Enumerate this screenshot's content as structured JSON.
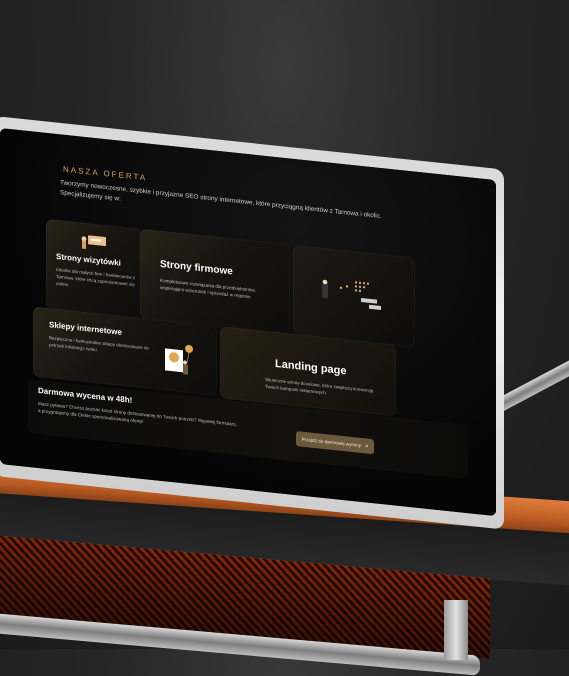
{
  "offer": {
    "eyebrow": "NASZA OFERTA",
    "intro": "Tworzymy nowoczesne, szybkie i przyjazne SEO strony internetowe, które przyciągną klientów z Tarnowa i okolic. Specjalizujemy się w:"
  },
  "cards": [
    {
      "title": "Strony wizytówki",
      "desc": "Idealne dla małych firm i freelancerów z Tarnowa, które chcą zaprezentować się online"
    },
    {
      "title": "Strony firmowe",
      "desc": "Kompleksowe rozwiązania dla przedsiębiorstw, wspierające wizerunek i sprzedaż w regionie"
    },
    {
      "title": "Sklepy internetowe",
      "desc": "Bezpieczne i funkcjonalne sklepy dostosowane do potrzeb lokalnego rynku"
    },
    {
      "title": "Landing page",
      "desc": "Skuteczne strony docelowe, które zwiększą konwersję Twoich kampanii reklamowych."
    }
  ],
  "cta": {
    "title": "Darmowa wycena w 48h!",
    "desc": "Masz pytania? Chcesz poznać koszt strony dostosowanej do Twoich potrzeb? Wypełnij formularz, a przygotujemy dla Ciebie spersonalizowaną ofertę!",
    "button": "Przejdź do darmowej wyceny",
    "button_icon": "double-chevron-right-icon",
    "accent": "#d7a35c",
    "button_color": "#6b5a3c"
  }
}
